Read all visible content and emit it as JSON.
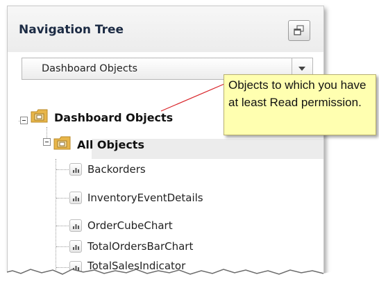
{
  "panel": {
    "title": "Navigation Tree"
  },
  "dropdown": {
    "value": "Dashboard Objects"
  },
  "tree": {
    "root": {
      "label": "Dashboard Objects"
    },
    "group": {
      "label": "All Objects"
    },
    "items": [
      {
        "label": "Backorders"
      },
      {
        "label": "InventoryEventDetails"
      },
      {
        "label": "OrderCubeChart"
      },
      {
        "label": "TotalOrdersBarChart"
      },
      {
        "label": "TotalSalesIndicator"
      }
    ]
  },
  "callout": {
    "text": "Objects to which you have at least Read permission."
  },
  "colors": {
    "callout_background": "#ffffb0",
    "callout_leader": "#d9252a",
    "selection": "#ececec",
    "folder": "#e8b64a"
  }
}
